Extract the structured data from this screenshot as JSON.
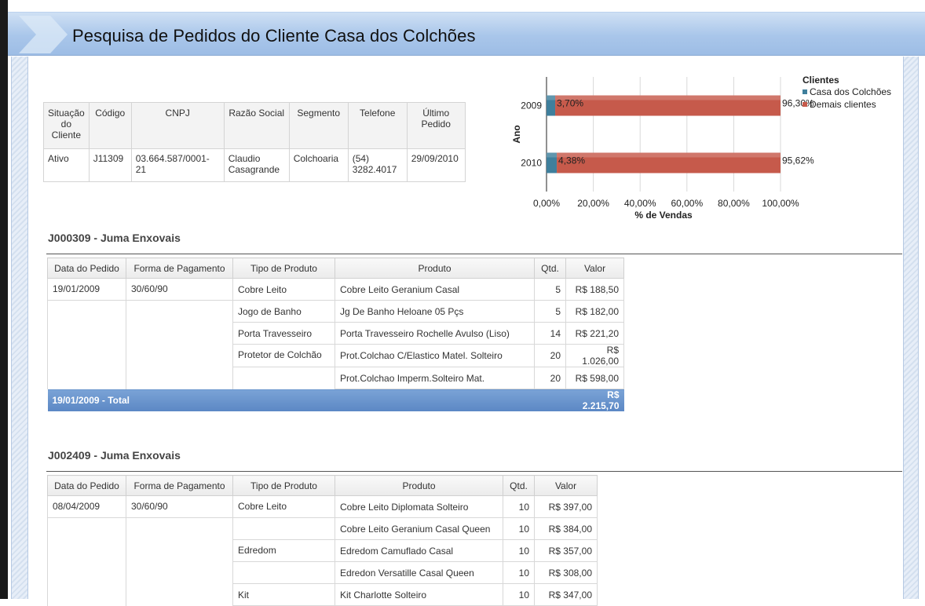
{
  "page": {
    "title": "Pesquisa de Pedidos do Cliente Casa dos Colchões"
  },
  "client_table": {
    "headers": [
      "Situação do Cliente",
      "Código",
      "CNPJ",
      "Razão Social",
      "Segmento",
      "Telefone",
      "Último Pedido"
    ],
    "row": [
      "Ativo",
      "J11309",
      "03.664.587/0001-21",
      "Claudio Casagrande",
      "Colchoaria",
      "(54) 3282.4017",
      "29/09/2010"
    ]
  },
  "chart_data": {
    "type": "bar",
    "orientation": "horizontal",
    "stacked": true,
    "categories": [
      "2009",
      "2010"
    ],
    "series": [
      {
        "name": "Casa dos Colchões",
        "values": [
          3.7,
          4.38
        ],
        "labels": [
          "3,70%",
          "4,38%"
        ],
        "color": "#3f7f9c"
      },
      {
        "name": "Demais clientes",
        "values": [
          96.3,
          95.62
        ],
        "labels": [
          "96,30%",
          "95,62%"
        ],
        "color": "#c65a4b"
      }
    ],
    "xlabel": "% de Vendas",
    "ylabel": "Ano",
    "xlim": [
      0,
      100
    ],
    "x_ticks": [
      "0,00%",
      "20,00%",
      "40,00%",
      "60,00%",
      "80,00%",
      "100,00%"
    ],
    "legend_title": "Clientes",
    "legend_position": "right",
    "grid": true
  },
  "orders": [
    {
      "title": "J000309 - Juma Enxovais",
      "headers": [
        "Data do Pedido",
        "Forma de Pagamento",
        "Tipo de Produto",
        "Produto",
        "Qtd.",
        "Valor"
      ],
      "date": "19/01/2009",
      "payment": "30/60/90",
      "groups": [
        {
          "tipo": "Cobre Leito",
          "items": [
            {
              "produto": "Cobre Leito Geranium Casal",
              "qtd": "5",
              "valor": "R$ 188,50"
            }
          ]
        },
        {
          "tipo": "Jogo de Banho",
          "items": [
            {
              "produto": "Jg De Banho Heloane 05 Pçs",
              "qtd": "5",
              "valor": "R$ 182,00"
            }
          ]
        },
        {
          "tipo": "Porta Travesseiro",
          "items": [
            {
              "produto": "Porta Travesseiro Rochelle Avulso (Liso)",
              "qtd": "14",
              "valor": "R$ 221,20"
            }
          ]
        },
        {
          "tipo": "Protetor de Colchão",
          "items": [
            {
              "produto": "Prot.Colchao C/Elastico Matel. Solteiro",
              "qtd": "20",
              "valor": "R$ 1.026,00"
            },
            {
              "produto": "Prot.Colchao Imperm.Solteiro Mat.",
              "qtd": "20",
              "valor": "R$ 598,00"
            }
          ]
        }
      ],
      "total_label": "19/01/2009 - Total",
      "total_value": "R$ 2.215,70"
    },
    {
      "title": "J002409 - Juma Enxovais",
      "headers": [
        "Data do Pedido",
        "Forma de Pagamento",
        "Tipo de Produto",
        "Produto",
        "Qtd.",
        "Valor"
      ],
      "date": "08/04/2009",
      "payment": "30/60/90",
      "groups": [
        {
          "tipo": "Cobre Leito",
          "items": [
            {
              "produto": "Cobre Leito Diplomata Solteiro",
              "qtd": "10",
              "valor": "R$ 397,00"
            },
            {
              "produto": "Cobre Leito Geranium Casal Queen",
              "qtd": "10",
              "valor": "R$ 384,00"
            }
          ]
        },
        {
          "tipo": "Edredom",
          "items": [
            {
              "produto": "Edredom Camuflado Casal",
              "qtd": "10",
              "valor": "R$ 357,00"
            },
            {
              "produto": "Edredon Versatille Casal Queen",
              "qtd": "10",
              "valor": "R$ 308,00"
            }
          ]
        },
        {
          "tipo": "Kit",
          "items": [
            {
              "produto": "Kit Charlotte Solteiro",
              "qtd": "10",
              "valor": "R$ 347,00"
            }
          ]
        }
      ],
      "total_label": "",
      "total_value": ""
    }
  ]
}
